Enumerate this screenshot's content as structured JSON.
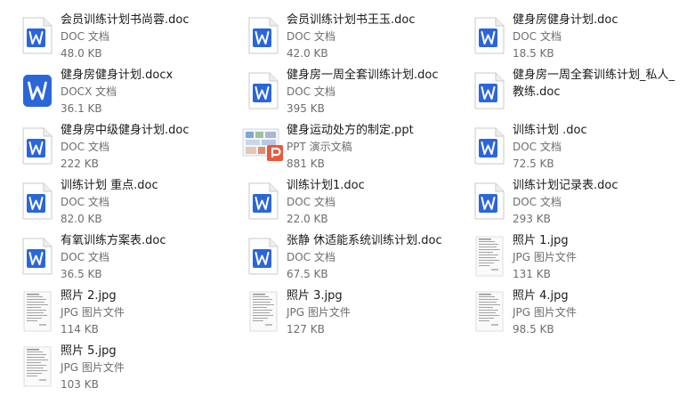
{
  "files": [
    {
      "name": "会员训练计划书尚蓉.doc",
      "type": "DOC 文档",
      "size": "48.0 KB",
      "icon": "doc-file-icon"
    },
    {
      "name": "会员训练计划书王玉.doc",
      "type": "DOC 文档",
      "size": "42.0 KB",
      "icon": "doc-file-icon"
    },
    {
      "name": "健身房健身计划.doc",
      "type": "DOC 文档",
      "size": "18.5 KB",
      "icon": "doc-file-icon"
    },
    {
      "name": "健身房健身计划.docx",
      "type": "DOCX 文档",
      "size": "36.1 KB",
      "icon": "docx-file-icon"
    },
    {
      "name": "健身房一周全套训练计划.doc",
      "type": "DOC 文档",
      "size": "395 KB",
      "icon": "doc-file-icon"
    },
    {
      "name": "健身房一周全套训练计划_私人_教练.doc",
      "type": "",
      "size": "",
      "icon": "doc-file-icon"
    },
    {
      "name": "健身房中级健身计划.doc",
      "type": "DOC 文档",
      "size": "222 KB",
      "icon": "doc-file-icon"
    },
    {
      "name": "健身运动处方的制定.ppt",
      "type": "PPT 演示文稿",
      "size": "881 KB",
      "icon": "ppt-thumbnail-icon"
    },
    {
      "name": "训练计划 .doc",
      "type": "DOC 文档",
      "size": "72.5 KB",
      "icon": "doc-file-icon"
    },
    {
      "name": "训练计划 重点.doc",
      "type": "DOC 文档",
      "size": "82.0 KB",
      "icon": "doc-file-icon"
    },
    {
      "name": "训练计划1.doc",
      "type": "DOC 文档",
      "size": "22.0 KB",
      "icon": "doc-file-icon"
    },
    {
      "name": "训练计划记录表.doc",
      "type": "DOC 文档",
      "size": "293 KB",
      "icon": "doc-file-icon"
    },
    {
      "name": "有氧训练方案表.doc",
      "type": "DOC 文档",
      "size": "36.5 KB",
      "icon": "doc-file-icon"
    },
    {
      "name": "张静 休适能系统训练计划.doc",
      "type": "DOC 文档",
      "size": "67.5 KB",
      "icon": "doc-file-icon"
    },
    {
      "name": "照片 1.jpg",
      "type": "JPG 图片文件",
      "size": "131 KB",
      "icon": "jpg-thumbnail-icon"
    },
    {
      "name": "照片 2.jpg",
      "type": "JPG 图片文件",
      "size": "114 KB",
      "icon": "jpg-thumbnail-icon"
    },
    {
      "name": "照片 3.jpg",
      "type": "JPG 图片文件",
      "size": "127 KB",
      "icon": "jpg-thumbnail-icon"
    },
    {
      "name": "照片 4.jpg",
      "type": "JPG 图片文件",
      "size": "98.5 KB",
      "icon": "jpg-thumbnail-icon"
    },
    {
      "name": "照片 5.jpg",
      "type": "JPG 图片文件",
      "size": "103 KB",
      "icon": "jpg-thumbnail-icon"
    }
  ],
  "colors": {
    "word_blue": "#2b66d9",
    "word_blue_light": "#dfe8fa",
    "ppt_orange": "#e8593c",
    "text": "#1a1a1a",
    "muted": "#6d6d6d"
  }
}
